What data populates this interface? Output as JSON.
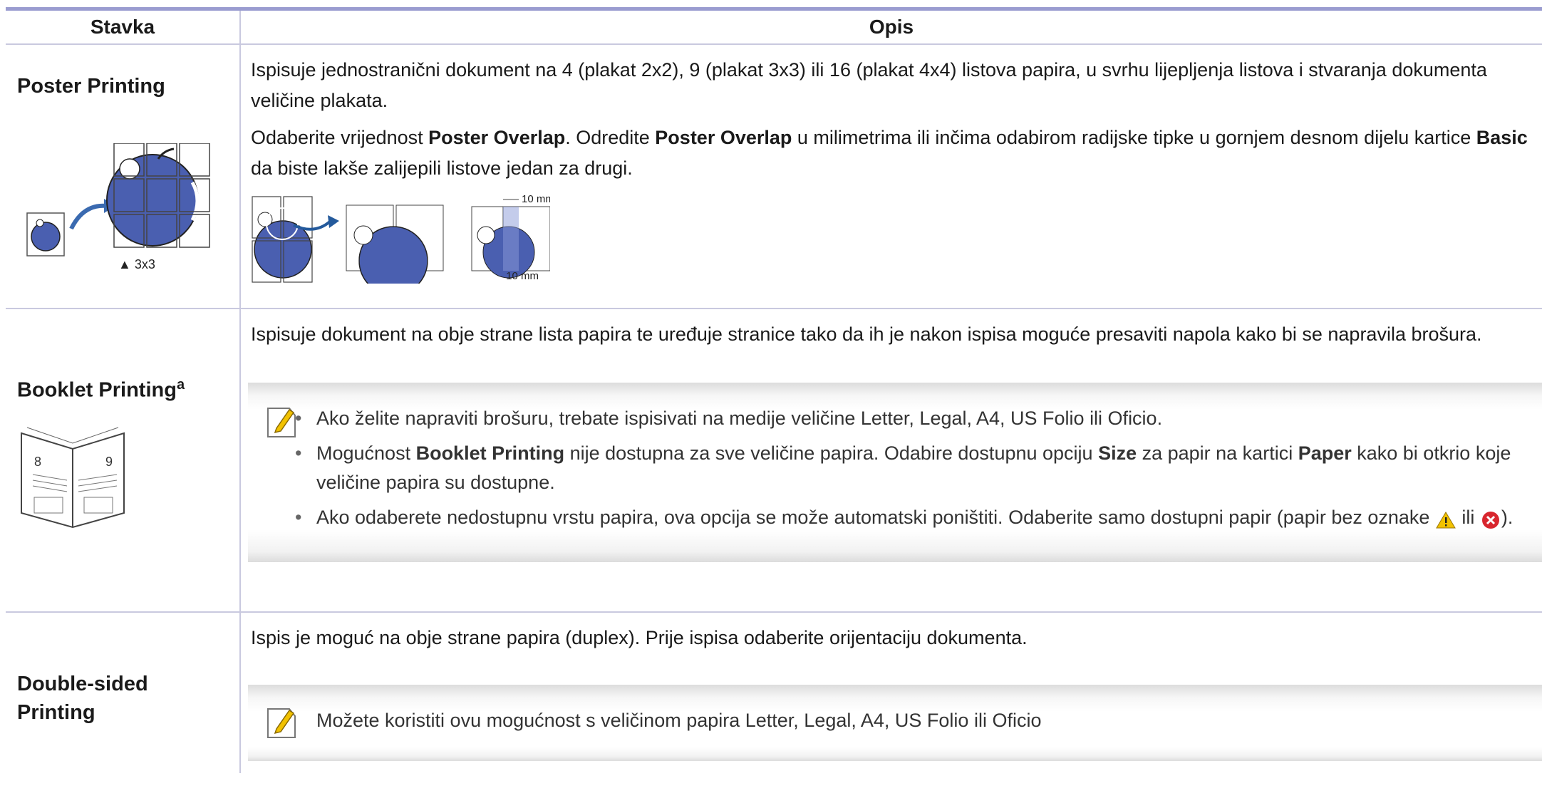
{
  "header": {
    "col1": "Stavka",
    "col2": "Opis"
  },
  "rows": [
    {
      "name": "Poster Printing",
      "figure_label": "▲ 3x3",
      "p1": "Ispisuje jednostranični dokument na 4 (plakat 2x2), 9 (plakat 3x3) ili 16 (plakat 4x4) listova papira, u svrhu lijepljenja listova i stvaranja dokumenta veličine plakata.",
      "p2": {
        "t1": "Odaberite vrijednost ",
        "b1": "Poster Overlap",
        "t2": ". Odredite ",
        "b2": "Poster Overlap",
        "t3": " u milimetrima ili inčima odabirom radijske tipke u gornjem desnom dijelu kartice ",
        "b3": "Basic",
        "t4": " da biste lakše zalijepili listove jedan za drugi."
      },
      "overlap_label_top": "10 mm",
      "overlap_label_bottom": "10 mm"
    },
    {
      "name": "Booklet Printing",
      "superscript": "a",
      "p1": "Ispisuje dokument na obje strane lista papira te uređuje stranice tako da ih je nakon ispisa moguće presaviti napola kako bi se napravila brošura.",
      "book_page_left": "8",
      "book_page_right": "9",
      "note_bullets": {
        "b1": "Ako želite napraviti brošuru, trebate ispisivati na medije veličine Letter, Legal, A4, US Folio ili Oficio.",
        "b2": {
          "t1": "Mogućnost ",
          "bold1": "Booklet Printing",
          "t2": " nije dostupna za sve veličine papira. Odabire dostupnu opciju ",
          "bold2": "Size",
          "t3": " za papir na kartici ",
          "bold3": "Paper",
          "t4": " kako bi otkrio koje veličine papira su dostupne."
        },
        "b3": {
          "t1": "Ako odaberete nedostupnu vrstu papira, ova opcija se može automatski poništiti. Odaberite samo dostupni papir (papir bez oznake ",
          "t2": " ili ",
          "t3": ")."
        }
      }
    },
    {
      "name_line1": "Double-sided",
      "name_line2": "Printing",
      "p1": "Ispis je moguć na obje strane papira (duplex). Prije ispisa odaberite orijentaciju dokumenta.",
      "note": "Možete koristiti ovu mogućnost s veličinom papira Letter, Legal, A4, US Folio ili Oficio"
    }
  ],
  "icons": {
    "note": "note-pencil-icon",
    "warning": "warning-triangle-icon",
    "error": "red-x-icon"
  },
  "colors": {
    "header_rule": "#9a9cd0",
    "apple_blue": "#4a5fb0",
    "arrow_blue": "#3a6ab0",
    "warning_yellow": "#f2c200",
    "error_red": "#d8262e"
  }
}
